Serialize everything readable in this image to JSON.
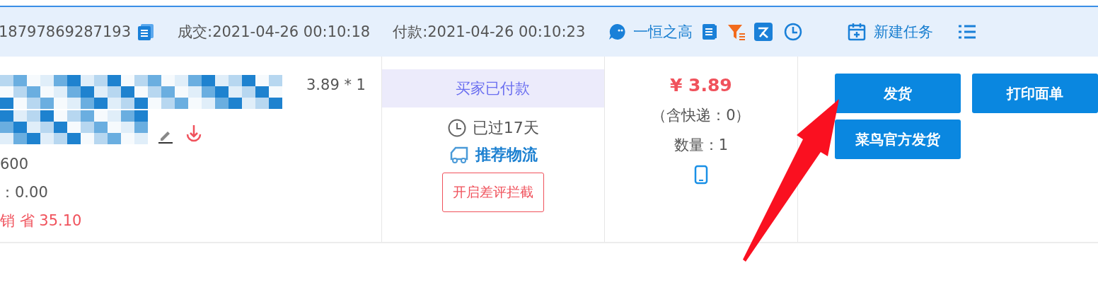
{
  "header": {
    "order_id": "18797869287193",
    "deal_time": "成交:2021-04-26 00:10:18",
    "pay_time": "付款:2021-04-26 00:10:23",
    "buyer": "一恒之高",
    "new_task": "新建任务"
  },
  "item": {
    "unit_price": "3.89 * 1",
    "line_1": "600",
    "line_2": "：0.00",
    "promo": "销 省 35.10"
  },
  "status": {
    "label": "买家已付款",
    "elapsed": "已过17天",
    "logistics": "推荐物流",
    "intercept": "开启差评拦截"
  },
  "price": {
    "total": "¥ 3.89",
    "shipping": "（含快递：0）",
    "quantity": "数量：1"
  },
  "actions": [
    {
      "label": "发货"
    },
    {
      "label": "打印面单"
    },
    {
      "label": "菜鸟官方发货"
    }
  ]
}
